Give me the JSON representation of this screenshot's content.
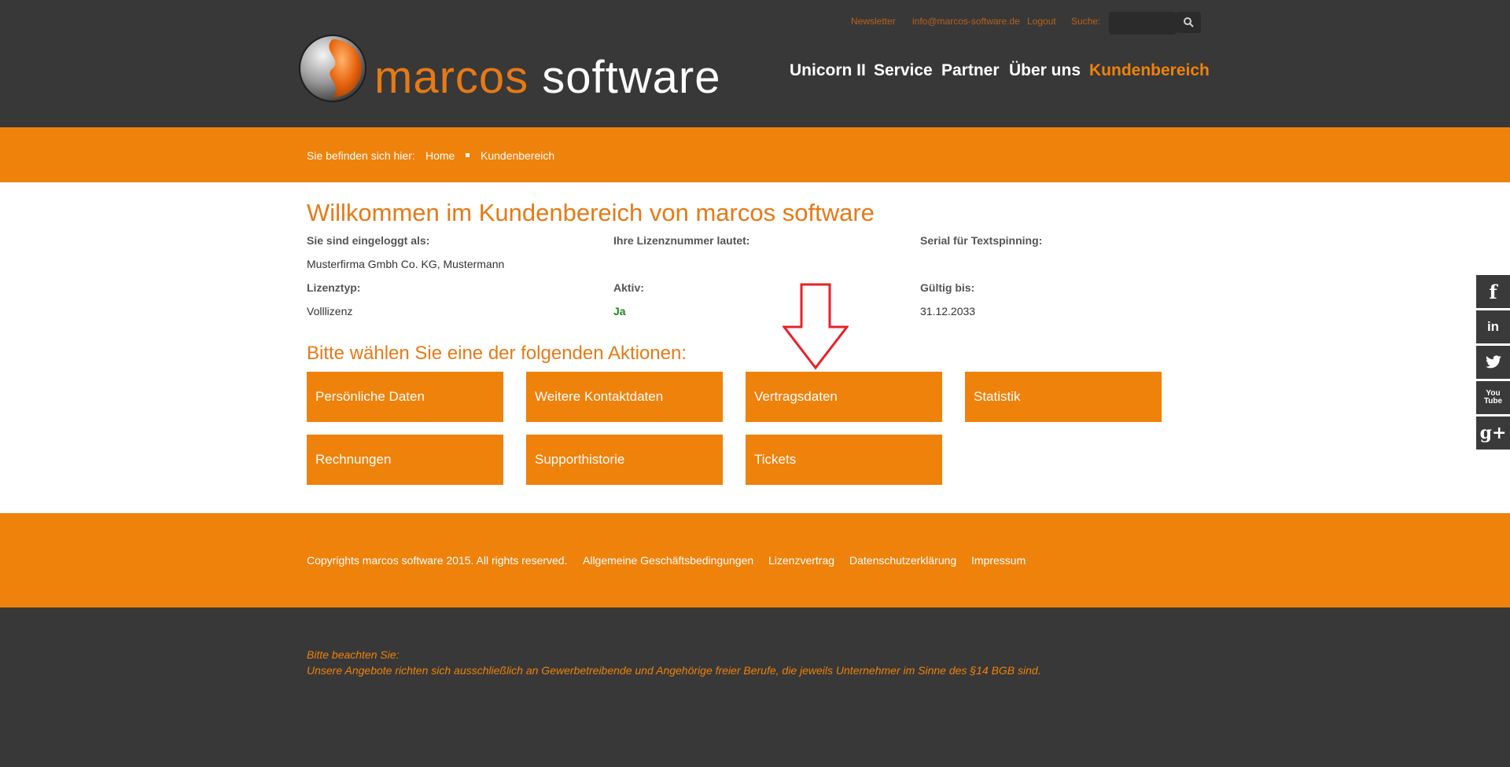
{
  "header": {
    "logo": {
      "word1": "marcos",
      "word2": "software"
    },
    "top_links": {
      "newsletter": "Newsletter",
      "email": "info@marcos-software.de",
      "logout": "Logout",
      "search_label": "Suche:"
    },
    "nav": [
      "Unicorn II",
      "Service",
      "Partner",
      "Über uns",
      "Kundenbereich"
    ]
  },
  "breadcrumb": {
    "prefix": "Sie befinden sich hier:",
    "items": [
      "Home",
      "Kundenbereich"
    ]
  },
  "main": {
    "title": "Willkommen im Kundenbereich von marcos software",
    "info": {
      "logged_in_label": "Sie sind eingeloggt als:",
      "logged_in_value": "Musterfirma Gmbh Co. KG, Mustermann",
      "license_number_label": "Ihre Lizenznummer lautet:",
      "serial_label": "Serial für Textspinning:",
      "license_type_label": "Lizenztyp:",
      "license_type_value": "Volllizenz",
      "active_label": "Aktiv:",
      "active_value": "Ja",
      "valid_until_label": "Gültig bis:",
      "valid_until_value": "31.12.2033"
    },
    "actions_title": "Bitte wählen Sie eine der folgenden Aktionen:",
    "actions": [
      "Persönliche Daten",
      "Weitere Kontaktdaten",
      "Vertragsdaten",
      "Statistik",
      "Rechnungen",
      "Supporthistorie",
      "Tickets"
    ]
  },
  "footer": {
    "copyright": "Copyrights marcos software 2015. All rights reserved.",
    "links": [
      "Allgemeine Geschäftsbedingungen",
      "Lizenzvertrag",
      "Datenschutzerklärung",
      "Impressum"
    ],
    "note_title": "Bitte beachten Sie:",
    "note_text": "Unsere Angebote richten sich ausschließlich an Gewerbetreibende und Angehörige freier Berufe, die jeweils Unternehmer im Sinne des §14 BGB sind."
  },
  "social": [
    "f",
    "in",
    "twitter-icon",
    "You Tube",
    "g+"
  ],
  "colors": {
    "orange": "#ef820b",
    "dark": "#383838",
    "arrow": "#e8202a"
  }
}
